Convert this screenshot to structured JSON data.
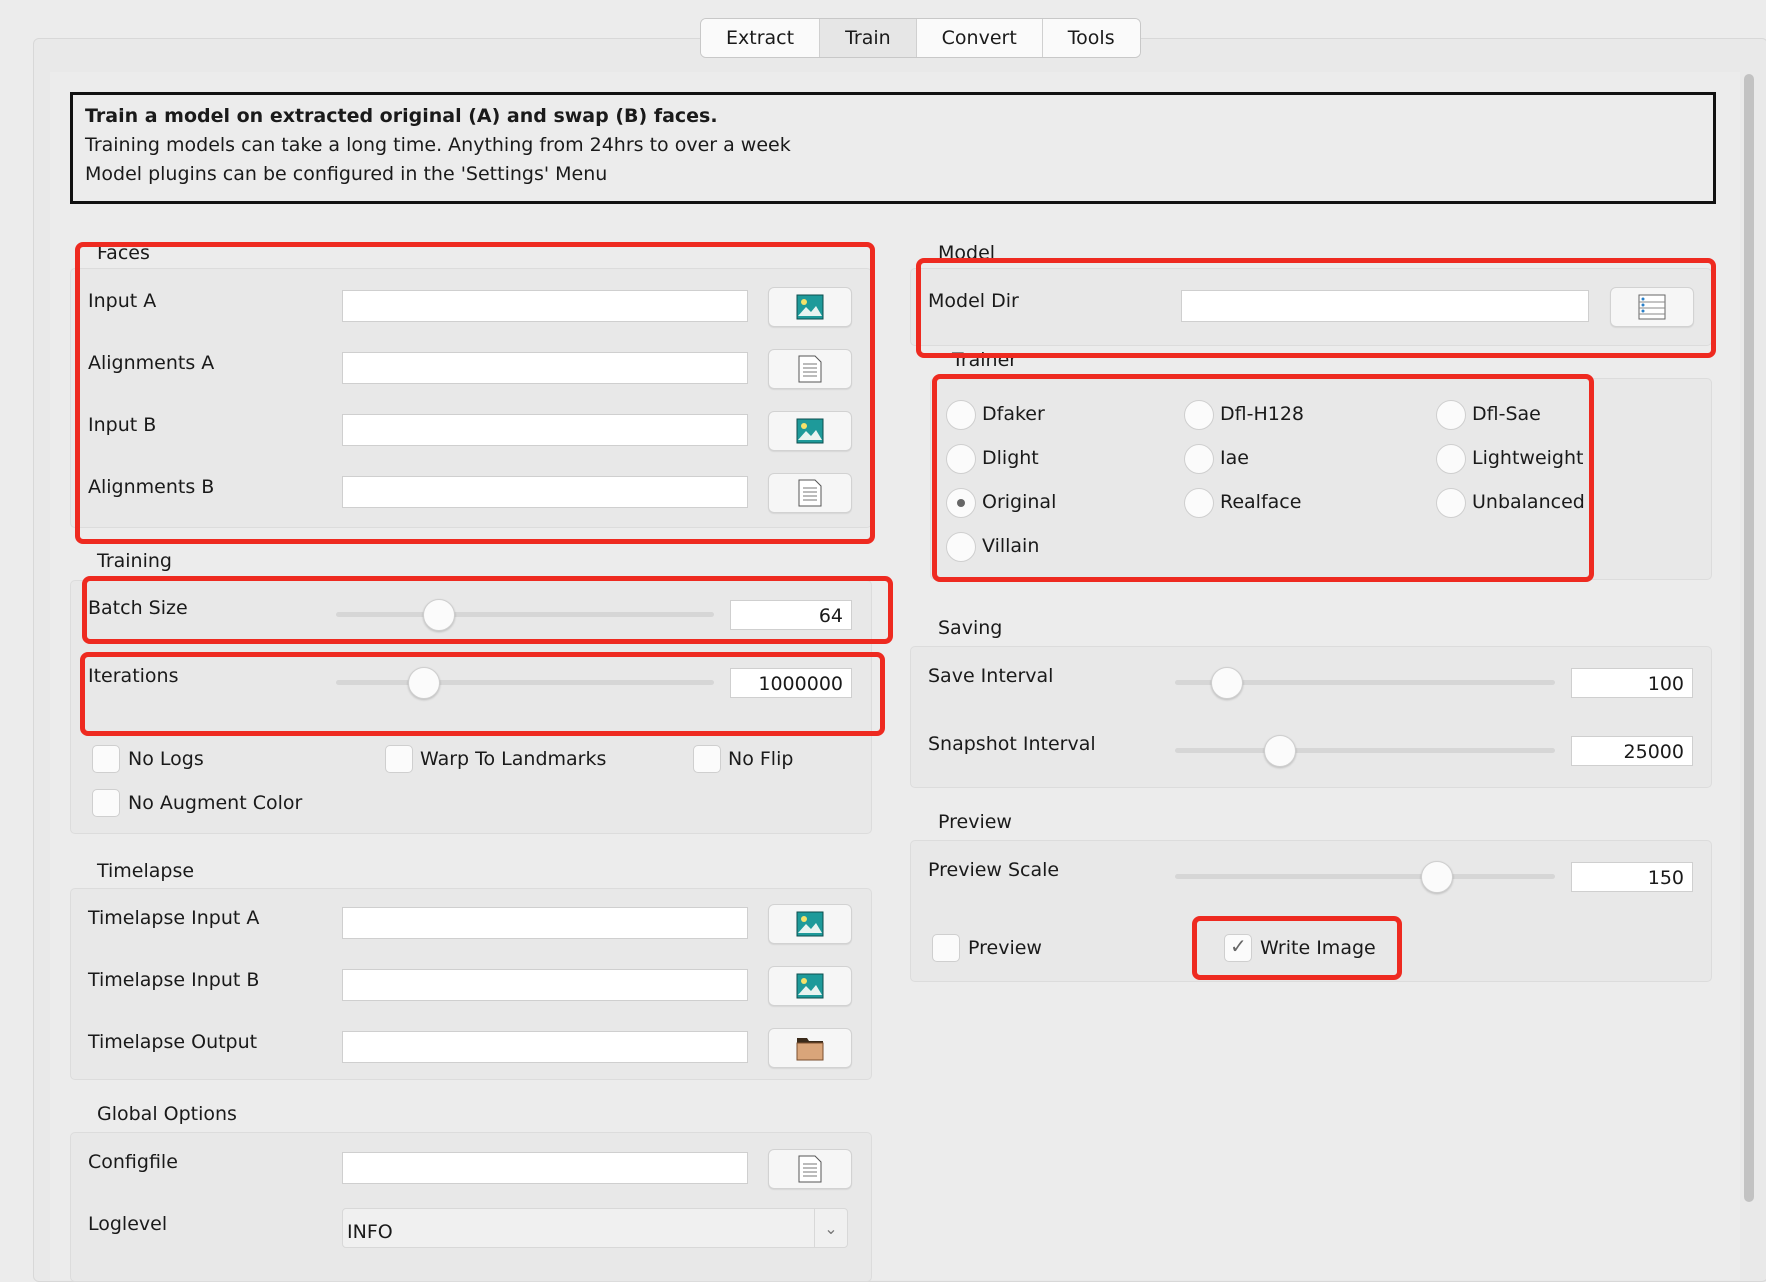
{
  "tabs": [
    {
      "label": "Extract"
    },
    {
      "label": "Train"
    },
    {
      "label": "Convert"
    },
    {
      "label": "Tools"
    }
  ],
  "info": {
    "title": "Train a model on extracted original (A) and swap (B) faces.",
    "line1": "Training models can take a long time. Anything from 24hrs to over a week",
    "line2": "Model plugins can be configured in the 'Settings' Menu"
  },
  "faces": {
    "title": "Faces",
    "input_a": "Input A",
    "alignments_a": "Alignments A",
    "input_b": "Input B",
    "alignments_b": "Alignments B"
  },
  "training": {
    "title": "Training",
    "batch_size_label": "Batch Size",
    "batch_size_value": "64",
    "iterations_label": "Iterations",
    "iterations_value": "1000000",
    "no_logs": "No Logs",
    "warp_to_landmarks": "Warp To Landmarks",
    "no_flip": "No Flip",
    "no_augment_color": "No Augment Color"
  },
  "timelapse": {
    "title": "Timelapse",
    "input_a": "Timelapse Input A",
    "input_b": "Timelapse Input B",
    "output": "Timelapse Output"
  },
  "global": {
    "title": "Global Options",
    "configfile": "Configfile",
    "loglevel": "Loglevel",
    "loglevel_value": "INFO"
  },
  "model": {
    "title": "Model",
    "model_dir": "Model Dir"
  },
  "trainer": {
    "title": "Trainer",
    "options": [
      "Dfaker",
      "Dfl-H128",
      "Dfl-Sae",
      "Dlight",
      "Iae",
      "Lightweight",
      "Original",
      "Realface",
      "Unbalanced",
      "Villain"
    ],
    "selected": "Original"
  },
  "saving": {
    "title": "Saving",
    "save_interval_label": "Save Interval",
    "save_interval_value": "100",
    "snapshot_interval_label": "Snapshot Interval",
    "snapshot_interval_value": "25000"
  },
  "preview": {
    "title": "Preview",
    "scale_label": "Preview Scale",
    "scale_value": "150",
    "preview_label": "Preview",
    "write_image_label": "Write Image"
  },
  "colors": {
    "highlight": "#ee2a20",
    "background": "#ececec"
  }
}
